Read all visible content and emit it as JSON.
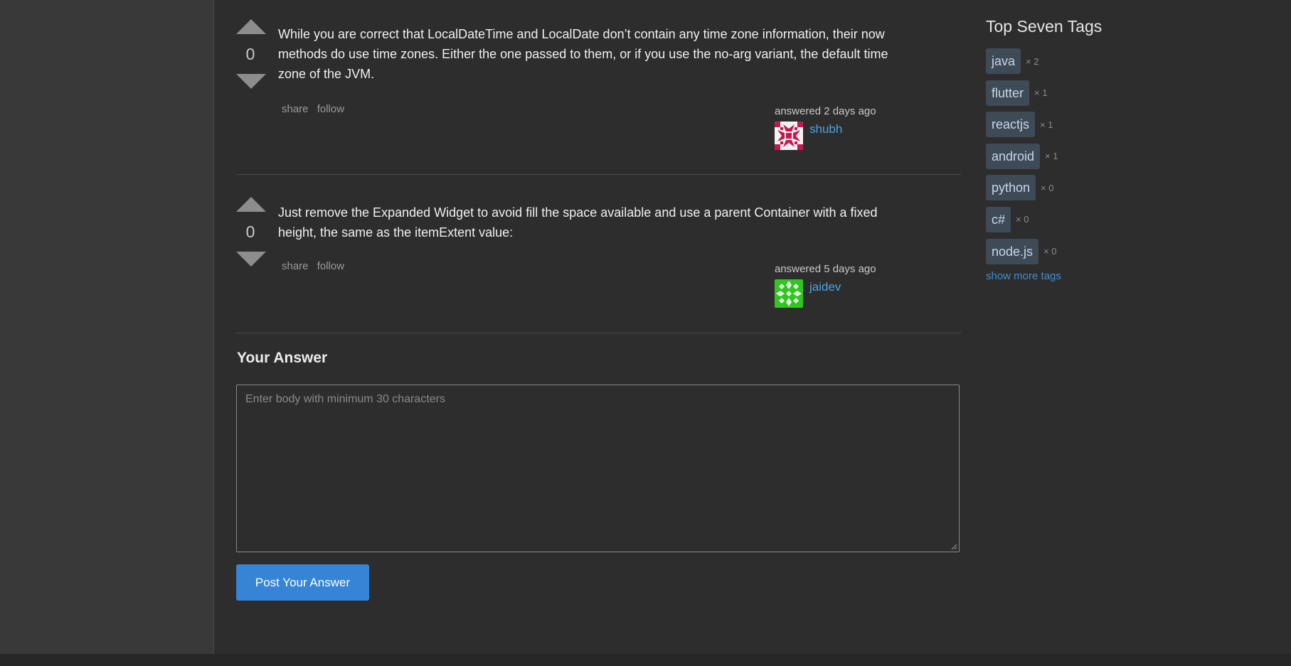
{
  "answers": [
    {
      "score": "0",
      "body": "While you are correct that LocalDateTime and LocalDate don’t contain any time zone information, their now methods do use time zones. Either the one passed to them, or if you use the no-arg variant, the default time zone of the JVM.",
      "share_label": "share",
      "follow_label": "follow",
      "answered_text": "answered 2 days ago",
      "username": "shubh",
      "avatar_color": "#c8174f"
    },
    {
      "score": "0",
      "body": "Just remove the Expanded Widget to avoid fill the space available and use a parent Container with a fixed height, the same as the itemExtent value:",
      "share_label": "share",
      "follow_label": "follow",
      "answered_text": "answered 5 days ago",
      "username": "jaidev",
      "avatar_color": "#2fc61e"
    }
  ],
  "your_answer": {
    "title": "Your Answer",
    "placeholder": "Enter body with minimum 30 characters",
    "value": "",
    "post_button_label": "Post Your Answer"
  },
  "sidebar": {
    "title": "Top Seven Tags",
    "tags": [
      {
        "name": "java",
        "count": "× 2"
      },
      {
        "name": "flutter",
        "count": "× 1"
      },
      {
        "name": "reactjs",
        "count": "× 1"
      },
      {
        "name": "android",
        "count": "× 1"
      },
      {
        "name": "python",
        "count": "× 0"
      },
      {
        "name": "c#",
        "count": "× 0"
      },
      {
        "name": "node.js",
        "count": "× 0"
      }
    ],
    "show_more_label": "show more tags"
  },
  "colors": {
    "background": "#2d2d2d",
    "accent_button": "#3584d6",
    "link": "#4ba3e6",
    "tag_bg": "#3e4a56"
  }
}
